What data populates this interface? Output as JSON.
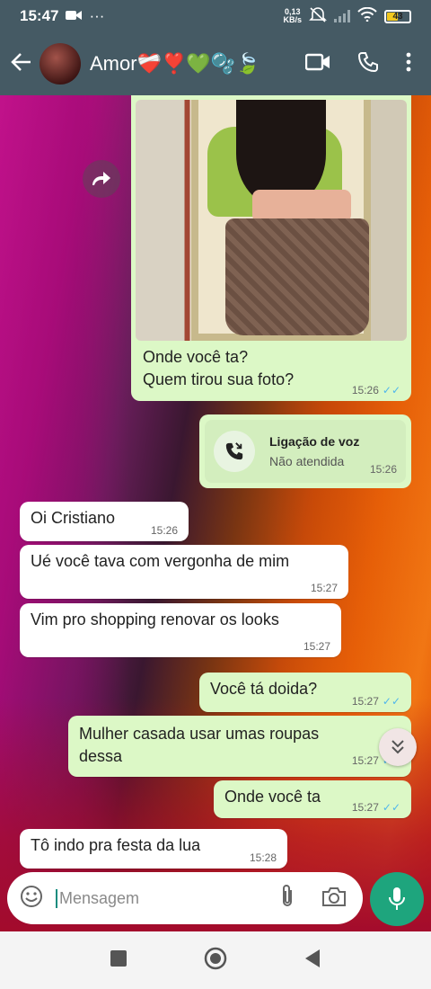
{
  "status_bar": {
    "time": "15:47",
    "more": "···",
    "net_top": "0,13",
    "net_bottom": "KB/s",
    "battery": "43"
  },
  "header": {
    "contact_name": "Amor❤️‍🩹❣️💚🫧🍃"
  },
  "messages": {
    "photo_caption_1": "Onde você ta?",
    "photo_caption_2": "Quem tirou sua foto?",
    "photo_time": "15:26",
    "call_title": "Ligação de voz",
    "call_status": "Não atendida",
    "call_time": "15:26",
    "m1_text": "Oi Cristiano",
    "m1_time": "15:26",
    "m2_text": "Ué você tava com vergonha de mim",
    "m2_time": "15:27",
    "m3_text": "Vim pro shopping renovar os looks",
    "m3_time": "15:27",
    "m4_text": "Você tá doida?",
    "m4_time": "15:27",
    "m5_text_1": "Mulher casada usar umas roupas",
    "m5_text_2": "dessa",
    "m5_time": "15:27",
    "m6_text": "Onde você ta",
    "m6_time": "15:27",
    "m7_text": "Tô indo pra festa da lua",
    "m7_time": "15:28"
  },
  "input": {
    "placeholder": "Mensagem"
  },
  "colors": {
    "header": "#455a64",
    "outgoing": "#dcf8c6",
    "incoming": "#ffffff",
    "accent": "#1ea57d",
    "read_ticks": "#4fb6ec"
  }
}
